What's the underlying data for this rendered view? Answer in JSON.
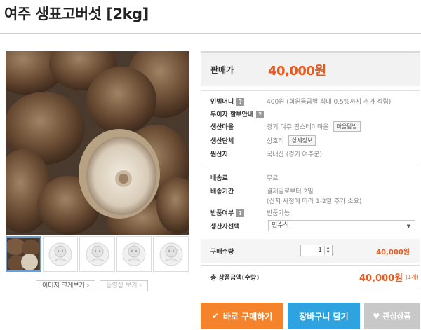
{
  "page": {
    "title": "여주 생표고버섯 [2kg]"
  },
  "gallery": {
    "thumbnail_count": 5,
    "zoom_button": "이미지 크게보기 ›",
    "video_button": "동영상 보기 ›"
  },
  "price": {
    "label": "판매가",
    "value": "40,000원"
  },
  "info": {
    "mileage": {
      "label": "인빌머니",
      "value": "400원 (회원등급별 최대 0.5%까지 추가 적립)"
    },
    "installment": {
      "label": "무이자 할부안내"
    },
    "village": {
      "label": "생산마을",
      "value": "경기 여주 팜스테이마을",
      "button": "마을탐방"
    },
    "group": {
      "label": "생산단체",
      "value": "상호리",
      "button": "상세정보"
    },
    "origin": {
      "label": "원산지",
      "value": "국내산 (경기 여주군)"
    },
    "shipping_fee": {
      "label": "배송료",
      "value": "무료"
    },
    "shipping_period": {
      "label": "배송기간",
      "value_line1": "결제일로부터 2일",
      "value_line2": "(산지 사정에 따라 1-2일 추가 소요)"
    },
    "returns": {
      "label": "반품여부",
      "value": "반품가능"
    },
    "producer": {
      "label": "생산자선택",
      "selected": "민수식"
    },
    "help_icon": "?"
  },
  "quantity": {
    "label": "구매수량",
    "value": "1",
    "line_price": "40,000원"
  },
  "total": {
    "label": "총 상품금액(수량)",
    "value": "40,000원",
    "count": "(1개)"
  },
  "actions": {
    "buy": "바로 구매하기",
    "cart": "장바구니 담기",
    "wish": "관심상품"
  },
  "colors": {
    "accent": "#e85a1e",
    "buy": "#f5832b",
    "cart": "#2fa3e0",
    "wish": "#c8c8c8"
  },
  "icons": {
    "buy": "check-icon",
    "wish": "heart-icon"
  }
}
